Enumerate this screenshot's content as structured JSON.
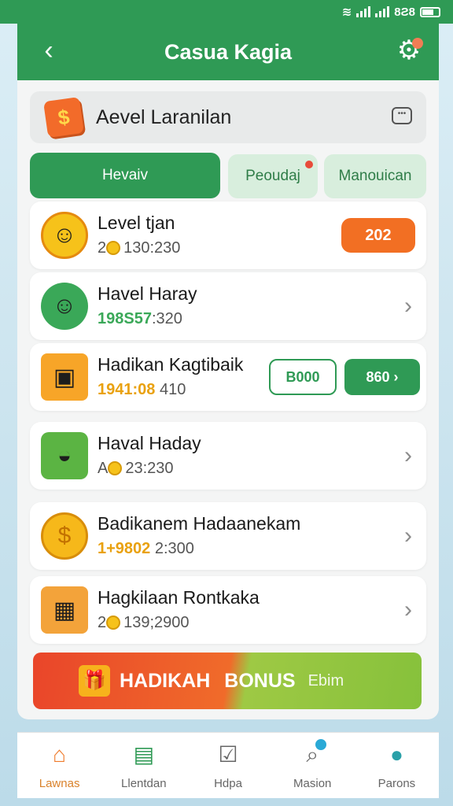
{
  "status": {
    "time": "8Ƨ8"
  },
  "header": {
    "title": "Casua Kagia"
  },
  "profile": {
    "name": "Aevel Laranilan",
    "badge_symbol": "$"
  },
  "tabs": [
    {
      "label": "Hevaiv",
      "active": true
    },
    {
      "label": "Peoudaj",
      "active": false
    },
    {
      "label": "Manouican",
      "active": false
    }
  ],
  "rows": [
    {
      "label": "Level tjan",
      "sub_prefix": "2",
      "sub": "130:230",
      "action": "202"
    },
    {
      "label": "Havel Haray",
      "sub_prefix": "198S57",
      "sub": ":320"
    },
    {
      "label": "Hadikan Kagtibaik",
      "sub_prefix": "1941:08",
      "sub": "410",
      "action_outline": "B000",
      "action_primary": "860 ›"
    },
    {
      "label": "Haval Haday",
      "sub_prefix": "A",
      "sub": "23:230"
    },
    {
      "label": "Badikanem Hadaanekam",
      "sub_prefix": "1+9802",
      "sub": "2:300"
    },
    {
      "label": "Hagkilaan Rontkaka",
      "sub_prefix": "2",
      "sub": "139;2900"
    }
  ],
  "banner": {
    "word1": "HADIKAH",
    "word2": "BONUS",
    "word3": "Ebim"
  },
  "nav": [
    {
      "label": "Lawnas",
      "icon": "home-icon",
      "active": true
    },
    {
      "label": "Llentdan",
      "icon": "list-icon",
      "active": false
    },
    {
      "label": "Hdpa",
      "icon": "checklist-icon",
      "active": false
    },
    {
      "label": "Masion",
      "icon": "search-icon",
      "active": false
    },
    {
      "label": "Parons",
      "icon": "person-icon",
      "active": false
    }
  ],
  "colors": {
    "primary": "#2f9a55",
    "accent": "#f26f23"
  }
}
